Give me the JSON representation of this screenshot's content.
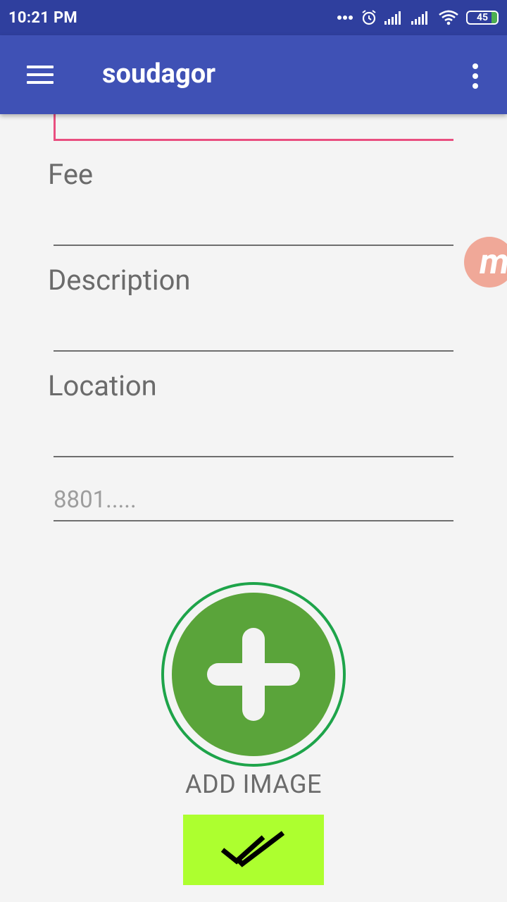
{
  "status_bar": {
    "time": "10:21 PM",
    "battery_level": "45",
    "icons": [
      "more-dots-icon",
      "alarm-icon",
      "signal-icon",
      "signal-icon",
      "wifi-icon",
      "battery-icon"
    ]
  },
  "app_bar": {
    "title": "soudagor",
    "menu_icon": "hamburger-menu-icon",
    "overflow_icon": "more-vert-icon"
  },
  "form": {
    "fee_label": "Fee",
    "description_label": "Description",
    "location_label": "Location",
    "phone_placeholder": "8801....."
  },
  "add_image": {
    "label": "ADD IMAGE",
    "icon": "plus-icon"
  },
  "submit": {
    "icon": "double-check-icon"
  },
  "colors": {
    "status_bar": "#2f3f9e",
    "app_bar": "#3f51b5",
    "focused_accent": "#e94f80",
    "add_button": "#5aa43a",
    "add_ring": "#1ea44a",
    "submit_button": "#adff2f"
  }
}
